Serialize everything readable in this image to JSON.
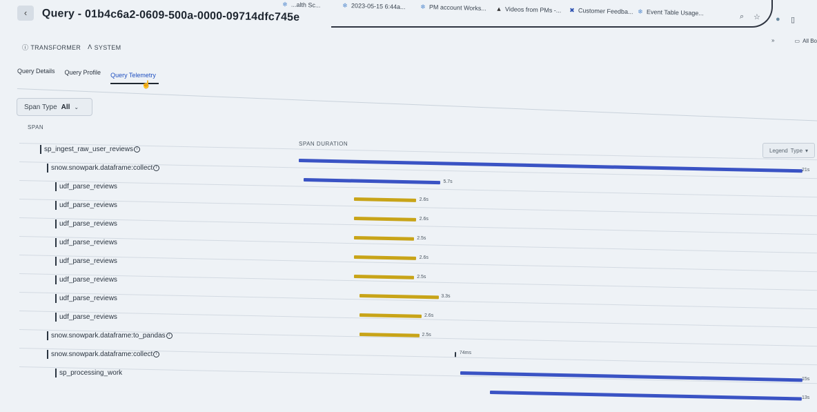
{
  "browser": {
    "bookmarks": [
      {
        "label": "...alth Sc...",
        "icon": "snowflake-icon"
      },
      {
        "label": "2023-05-15 6:44a...",
        "icon": "snowflake-icon"
      },
      {
        "label": "PM account Works...",
        "icon": "snowflake-icon"
      },
      {
        "label": "Videos from PMs -...",
        "icon": "drive-icon"
      },
      {
        "label": "Customer Feedba...",
        "icon": "x-icon"
      },
      {
        "label": "Event Table Usage...",
        "icon": "snowflake-icon"
      }
    ],
    "all_bookmarks_label": "All Bo"
  },
  "header": {
    "back_label": "‹",
    "title": "Query - 01b4c6a2-0609-500a-0000-09714dfc745e",
    "roles": [
      "TRANSFORMER",
      "SYSTEM"
    ]
  },
  "tabs": [
    {
      "label": "Query Details",
      "active": false
    },
    {
      "label": "Query Profile",
      "active": false
    },
    {
      "label": "Query Telemetry",
      "active": true
    }
  ],
  "filter": {
    "label": "Span Type",
    "value": "All"
  },
  "table": {
    "span_header": "SPAN",
    "duration_header": "SPAN DURATION",
    "legend_label": "Legend",
    "legend_value": "Type"
  },
  "colors": {
    "blue": "#3a53c4",
    "gold": "#c8a418"
  },
  "spans": [
    {
      "name": "sp_ingest_raw_user_reviews",
      "info": true,
      "depth": 0,
      "type": "blue",
      "start": 0.0,
      "duration_s": 21,
      "label": "21s"
    },
    {
      "name": "snow.snowpark.dataframe:collect",
      "info": true,
      "depth": 1,
      "type": "blue",
      "start": 0.01,
      "duration_s": 5.7,
      "label": "5.7s"
    },
    {
      "name": "udf_parse_reviews",
      "info": false,
      "depth": 2,
      "type": "gold",
      "start": 0.11,
      "duration_s": 2.6,
      "label": "2.6s"
    },
    {
      "name": "udf_parse_reviews",
      "info": false,
      "depth": 2,
      "type": "gold",
      "start": 0.11,
      "duration_s": 2.6,
      "label": "2.6s"
    },
    {
      "name": "udf_parse_reviews",
      "info": false,
      "depth": 2,
      "type": "gold",
      "start": 0.11,
      "duration_s": 2.5,
      "label": "2.5s"
    },
    {
      "name": "udf_parse_reviews",
      "info": false,
      "depth": 2,
      "type": "gold",
      "start": 0.11,
      "duration_s": 2.6,
      "label": "2.6s"
    },
    {
      "name": "udf_parse_reviews",
      "info": false,
      "depth": 2,
      "type": "gold",
      "start": 0.11,
      "duration_s": 2.5,
      "label": "2.5s"
    },
    {
      "name": "udf_parse_reviews",
      "info": false,
      "depth": 2,
      "type": "gold",
      "start": 0.12,
      "duration_s": 3.3,
      "label": "3.3s"
    },
    {
      "name": "udf_parse_reviews",
      "info": false,
      "depth": 2,
      "type": "gold",
      "start": 0.12,
      "duration_s": 2.6,
      "label": "2.6s"
    },
    {
      "name": "udf_parse_reviews",
      "info": false,
      "depth": 2,
      "type": "gold",
      "start": 0.12,
      "duration_s": 2.5,
      "label": "2.5s"
    },
    {
      "name": "snow.snowpark.dataframe:to_pandas",
      "info": true,
      "depth": 1,
      "type": "tiny",
      "start": 0.31,
      "duration_s": 0.074,
      "label": "74ms"
    },
    {
      "name": "snow.snowpark.dataframe:collect",
      "info": true,
      "depth": 1,
      "type": "blue",
      "start": 0.32,
      "duration_s": 15,
      "label": "15s"
    },
    {
      "name": "sp_processing_work",
      "info": false,
      "depth": 2,
      "type": "blue",
      "start": 0.38,
      "duration_s": 13,
      "label": "13s"
    }
  ]
}
